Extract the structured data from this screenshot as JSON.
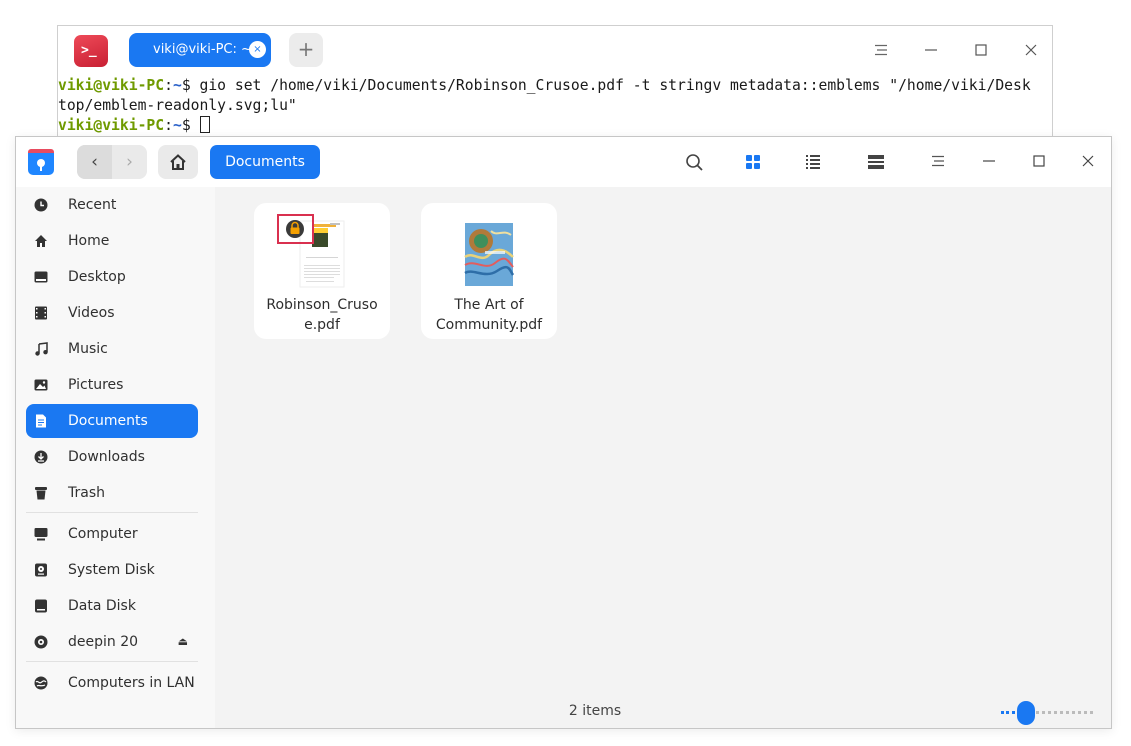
{
  "terminal": {
    "tab_title": "viki@viki-PC: ~",
    "tab_close_glyph": "×",
    "new_tab_glyph": "+",
    "icons": {
      "app": "terminal-app-icon",
      "menu": "hamburger-menu-icon",
      "minimize": "minimize-icon",
      "maximize": "maximize-icon",
      "close": "close-icon"
    },
    "prompt_user": "viki@viki-PC",
    "prompt_sep": ":",
    "prompt_path": "~",
    "prompt_symbol": "$ ",
    "command_line_1": "gio set /home/viki/Documents/Robinson_Crusoe.pdf -t stringv metadata::emblems \"/home/viki/Desk",
    "command_line_2": "top/emblem-readonly.svg;lu\""
  },
  "file_manager": {
    "breadcrumb": "Documents",
    "nav": {
      "back_glyph": "‹",
      "forward_glyph": "›"
    },
    "toolbar_icons": [
      "search-icon",
      "icon-view-icon",
      "list-view-icon",
      "tree-view-icon",
      "hamburger-menu-icon"
    ],
    "sidebar": {
      "items": [
        {
          "label": "Recent",
          "icon": "clock-icon"
        },
        {
          "label": "Home",
          "icon": "home-icon"
        },
        {
          "label": "Desktop",
          "icon": "desktop-icon"
        },
        {
          "label": "Videos",
          "icon": "film-icon"
        },
        {
          "label": "Music",
          "icon": "music-note-icon"
        },
        {
          "label": "Pictures",
          "icon": "picture-icon"
        },
        {
          "label": "Documents",
          "icon": "document-icon",
          "active": true
        },
        {
          "label": "Downloads",
          "icon": "download-icon"
        },
        {
          "label": "Trash",
          "icon": "trash-icon"
        }
      ],
      "devices": [
        {
          "label": "Computer",
          "icon": "computer-icon"
        },
        {
          "label": "System Disk",
          "icon": "system-disk-icon"
        },
        {
          "label": "Data Disk",
          "icon": "disk-icon"
        },
        {
          "label": "deepin 20",
          "icon": "optical-disc-icon",
          "eject_glyph": "⏏"
        }
      ],
      "network": [
        {
          "label": "Computers in LAN",
          "icon": "network-icon"
        }
      ]
    },
    "files": [
      {
        "name": "Robinson_Cruso\ne.pdf",
        "emblem": "lock-icon"
      },
      {
        "name": "The Art of\nCommunity.pdf"
      }
    ],
    "status": "2 items",
    "colors": {
      "accent": "#1a78f2",
      "emblem_highlight": "#d9304f",
      "sidebar_bg": "#f8f8f8",
      "content_bg": "#f3f3f3"
    }
  }
}
